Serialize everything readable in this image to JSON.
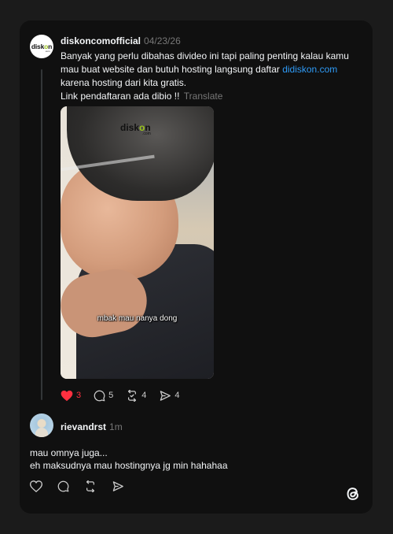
{
  "post": {
    "username": "diskoncomofficial",
    "date": "04/23/26",
    "avatar_logo": "diskon",
    "avatar_logo_sub": ".com",
    "text_line1": "Banyak yang perlu dibahas divideo ini tapi paling penting kalau kamu",
    "text_line2_pre": "mau buat website dan butuh hosting langsung daftar ",
    "text_link": "didiskon.com",
    "text_line3": "karena hosting dari kita gratis.",
    "text_line4": "Link pendaftaran ada dibio !!",
    "translate_label": "Translate",
    "video": {
      "watermark": "diskon",
      "watermark_sub": ".com",
      "caption": "mbak mau nanya dong"
    },
    "actions": {
      "likes": "3",
      "comments": "5",
      "reposts": "4",
      "shares": "4",
      "liked": true
    }
  },
  "reply": {
    "username": "rievandrst",
    "time": "1m",
    "line1": "mau omnya juga...",
    "line2": "eh maksudnya mau hostingnya jg min hahahaa"
  },
  "colors": {
    "background": "#1b1b1b",
    "card": "#101010",
    "link": "#2f9bf7",
    "like": "#ff3040",
    "muted": "#777777"
  },
  "icons": [
    "heart-icon",
    "comment-icon",
    "repost-icon",
    "share-icon",
    "threads-logo-icon"
  ]
}
